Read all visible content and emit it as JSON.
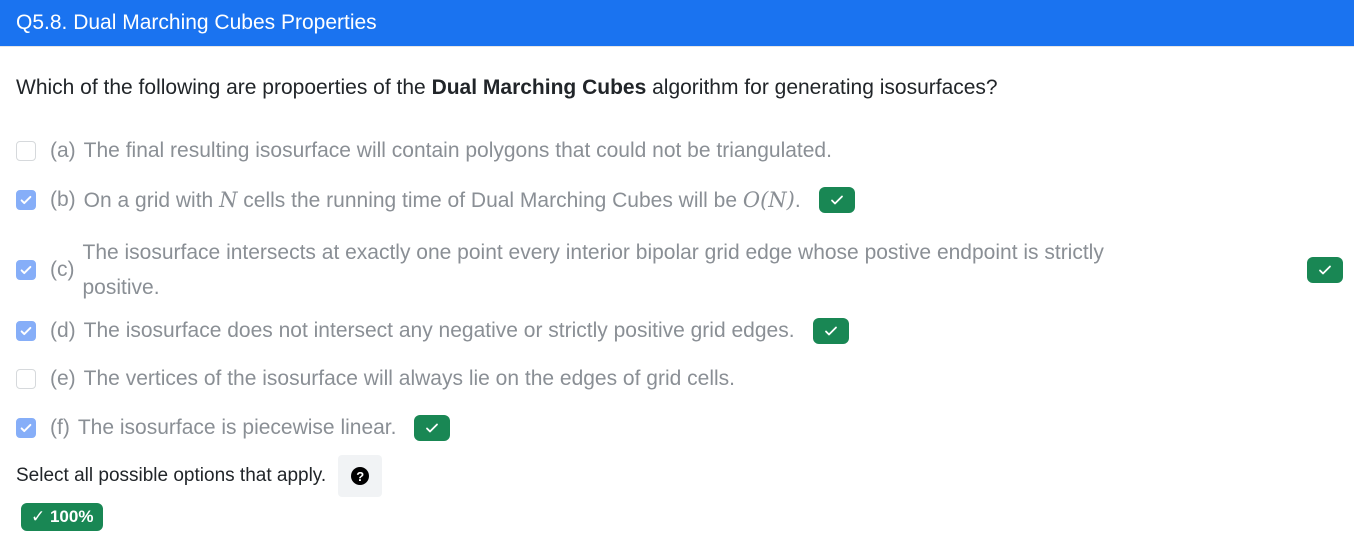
{
  "header": {
    "title": "Q5.8. Dual Marching Cubes Properties"
  },
  "question": {
    "prefix": "Which of the following are propoerties of the ",
    "bold": "Dual Marching Cubes",
    "suffix": " algorithm for generating isosurfaces?"
  },
  "options": [
    {
      "letter": "(a)",
      "text": "The final resulting isosurface will contain polygons that could not be triangulated.",
      "checked": false,
      "correct": false
    },
    {
      "letter": "(b)",
      "text_1": "On a grid with ",
      "math_1": "N",
      "text_2": " cells the running time of Dual Marching Cubes will be ",
      "math_2": "O(N)",
      "text_3": ".",
      "checked": true,
      "correct": true
    },
    {
      "letter": "(c)",
      "line1": "The isosurface intersects at exactly one point every interior bipolar grid edge whose postive endpoint is strictly",
      "line2": "positive.",
      "checked": true,
      "correct": true
    },
    {
      "letter": "(d)",
      "text": "The isosurface does not intersect any negative or strictly positive grid edges.",
      "checked": true,
      "correct": true
    },
    {
      "letter": "(e)",
      "text": "The vertices of the isosurface will always lie on the edges of grid cells.",
      "checked": false,
      "correct": false
    },
    {
      "letter": "(f)",
      "text": "The isosurface is piecewise linear.",
      "checked": true,
      "correct": true
    }
  ],
  "footer": {
    "hint": "Select all possible options that apply.",
    "help_icon": "question-circle-icon",
    "help_glyph": "?",
    "score": "✓ 100%"
  },
  "colors": {
    "header": "#1a73f0",
    "correct": "#198754",
    "checkbox_on": "#86aef8"
  }
}
